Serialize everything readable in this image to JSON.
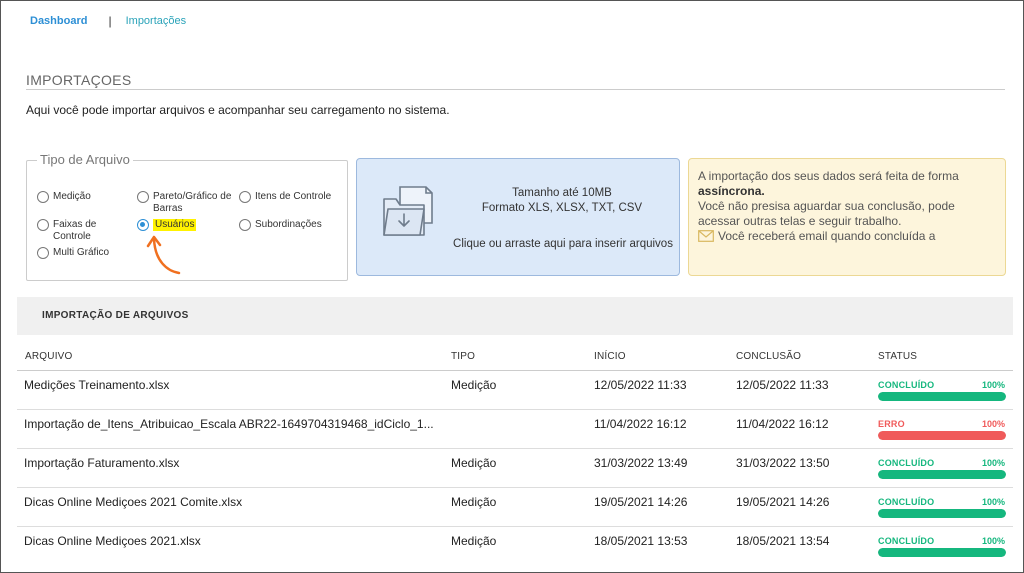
{
  "breadcrumb": {
    "dashboard": "Dashboard",
    "separator": "|",
    "current": "Importações"
  },
  "page": {
    "title": "IMPORTAÇOES",
    "description": "Aqui você pode importar arquivos e acompanhar seu carregamento no sistema."
  },
  "file_type": {
    "legend": "Tipo de Arquivo",
    "options": [
      {
        "label": "Medição",
        "selected": false
      },
      {
        "label": "Pareto/Gráfico de Barras",
        "selected": false
      },
      {
        "label": "Itens de Controle",
        "selected": false
      },
      {
        "label": "Faixas de Controle",
        "selected": false
      },
      {
        "label": "Usuários",
        "selected": true
      },
      {
        "label": "Subordinações",
        "selected": false
      },
      {
        "label": "Multi Gráfico",
        "selected": false
      }
    ]
  },
  "dropzone": {
    "size": "Tamanho até 10MB",
    "format": "Formato XLS, XLSX, TXT, CSV",
    "instruction": "Clique ou arraste aqui para inserir arquivos",
    "icon": "folder-upload-icon"
  },
  "info": {
    "line1": "A importação dos seus dados será feita de forma",
    "bold": "assíncrona.",
    "line2": "Você não presisa aguardar sua conclusão, pode acessar outras telas e seguir trabalho.",
    "email_note": "Você receberá email quando concluída a"
  },
  "imports_section": {
    "title": "IMPORTAÇÃO DE ARQUIVOS"
  },
  "table": {
    "headers": {
      "file": "ARQUIVO",
      "type": "TIPO",
      "start": "INÍCIO",
      "end": "CONCLUSÃO",
      "status": "STATUS"
    },
    "rows": [
      {
        "file": "Medições Treinamento.xlsx",
        "type": "Medição",
        "start": "12/05/2022 11:33",
        "end": "12/05/2022 11:33",
        "status": "CONCLUÍDO",
        "percent": "100%",
        "progress": 1.0,
        "color": "#15b77e"
      },
      {
        "file": "Importação de_Itens_Atribuicao_Escala ABR22-1649704319468_idCiclo_1...",
        "type": "",
        "start": "11/04/2022 16:12",
        "end": "11/04/2022 16:12",
        "status": "ERRO",
        "percent": "100%",
        "progress": 1.0,
        "color": "#f05a5a"
      },
      {
        "file": "Importação Faturamento.xlsx",
        "type": "Medição",
        "start": "31/03/2022 13:49",
        "end": "31/03/2022 13:50",
        "status": "CONCLUÍDO",
        "percent": "100%",
        "progress": 1.0,
        "color": "#15b77e"
      },
      {
        "file": "Dicas Online Mediçoes 2021 Comite.xlsx",
        "type": "Medição",
        "start": "19/05/2021 14:26",
        "end": "19/05/2021 14:26",
        "status": "CONCLUÍDO",
        "percent": "100%",
        "progress": 1.0,
        "color": "#15b77e"
      },
      {
        "file": "Dicas Online Mediçoes 2021.xlsx",
        "type": "Medição",
        "start": "18/05/2021 13:53",
        "end": "18/05/2021 13:54",
        "status": "CONCLUÍDO",
        "percent": "100%",
        "progress": 1.0,
        "color": "#15b77e"
      }
    ]
  },
  "colors": {
    "accent": "#2d8fd5",
    "success": "#15b77e",
    "error": "#f05a5a",
    "annotation": "#f07020"
  }
}
